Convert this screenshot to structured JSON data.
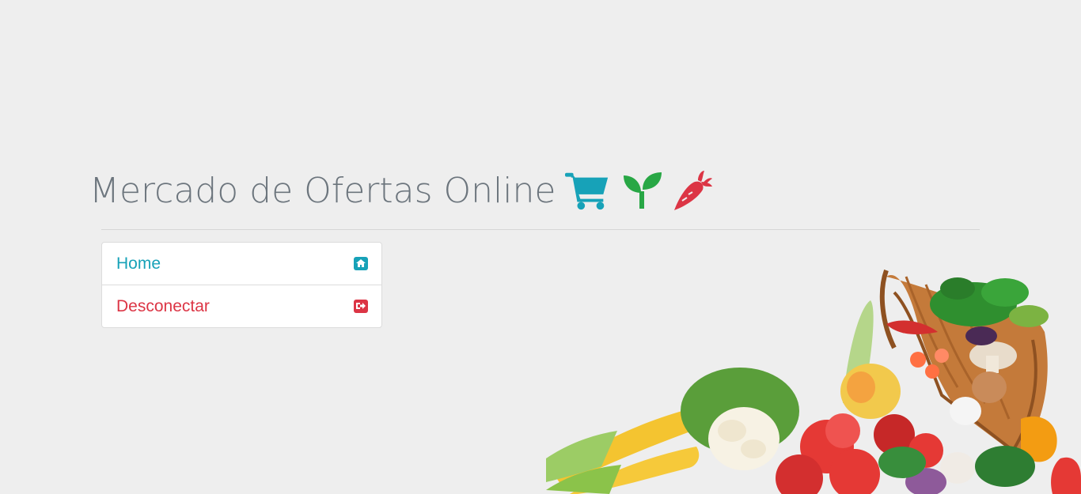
{
  "header": {
    "title": "Mercado de Ofertas Online",
    "icons": [
      "shopping-cart-icon",
      "seedling-icon",
      "carrot-icon"
    ],
    "icon_colors": {
      "cart": "#17a2b8",
      "seedling": "#28a745",
      "carrot": "#dc3545"
    }
  },
  "menu": {
    "items": [
      {
        "label": "Home",
        "icon": "home-icon",
        "color": "#17a2b8"
      },
      {
        "label": "Desconectar",
        "icon": "sign-out-icon",
        "color": "#dc3545"
      }
    ]
  },
  "colors": {
    "background": "#eeeeee",
    "title": "#6c757d"
  }
}
